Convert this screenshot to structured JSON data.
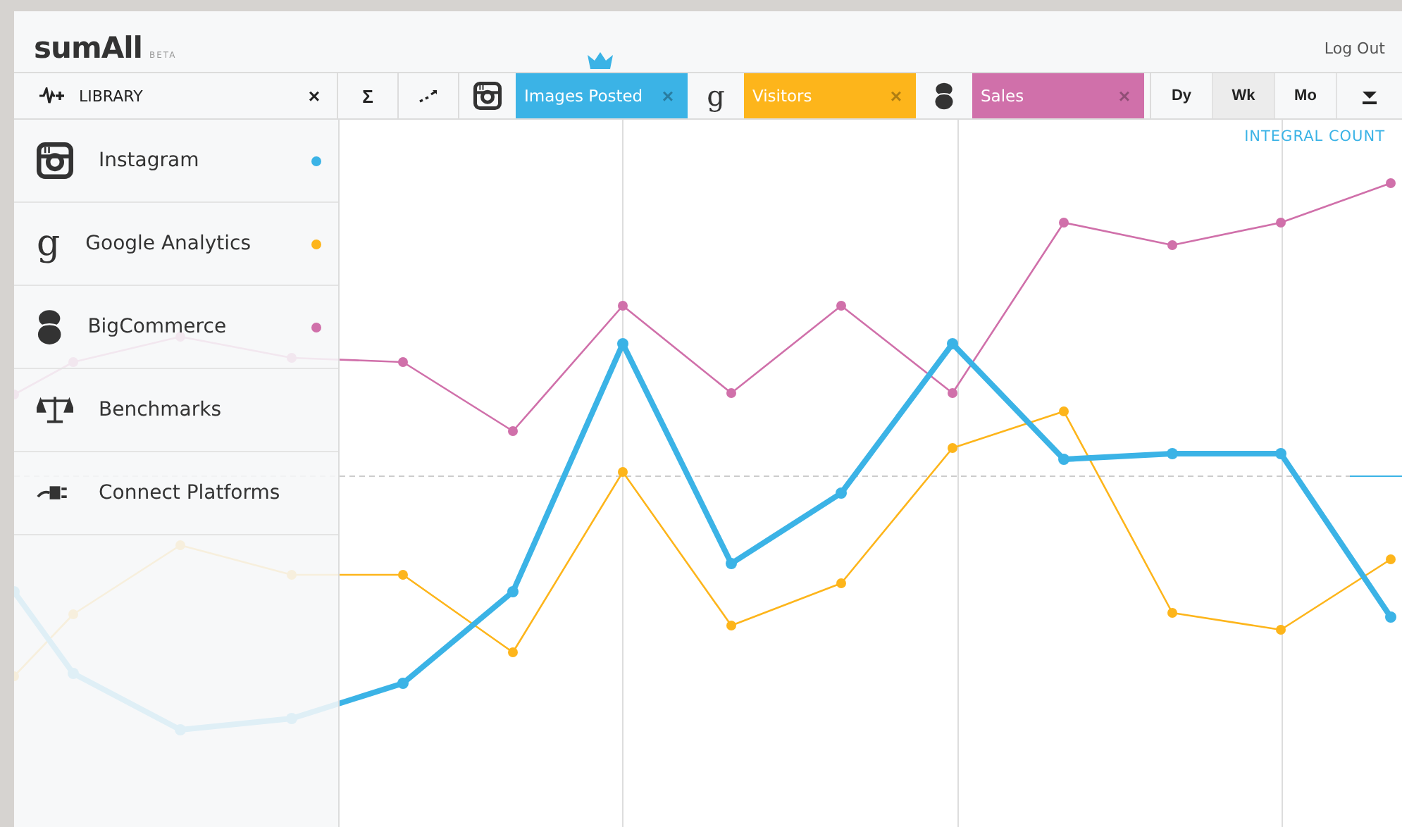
{
  "header": {
    "logo": "sumAll",
    "badge": "BETA",
    "logout": "Log Out"
  },
  "library": {
    "label": "LIBRARY",
    "close": "×"
  },
  "tools": [
    {
      "kind": "sum",
      "text": "Σ"
    },
    {
      "kind": "trend"
    }
  ],
  "metrics": [
    {
      "kind": "instagram",
      "label": "Images Posted",
      "close": "×",
      "color": "#3bb3e6",
      "selected": true
    },
    {
      "kind": "google",
      "glyph": "g",
      "label": "Visitors",
      "close": "×",
      "color": "#fdb51b",
      "selected": false
    },
    {
      "kind": "bigcommerce",
      "label": "Sales",
      "close": "×",
      "color": "#d070aa",
      "selected": false
    }
  ],
  "periods": [
    {
      "label": "Dy",
      "selected": false
    },
    {
      "label": "Wk",
      "selected": true
    },
    {
      "label": "Mo",
      "selected": false
    }
  ],
  "sidebar": {
    "items": [
      {
        "kind": "instagram",
        "label": "Instagram",
        "color": "#3bb3e6"
      },
      {
        "kind": "google",
        "glyph": "g",
        "label": "Google Analytics",
        "color": "#fdb51b"
      },
      {
        "kind": "bigcommerce",
        "label": "BigCommerce",
        "color": "#d070aa"
      },
      {
        "kind": "scale",
        "label": "Benchmarks"
      },
      {
        "kind": "plug",
        "label": "Connect Platforms"
      }
    ]
  },
  "chart": {
    "mode": "INTEGRAL COUNT"
  }
}
